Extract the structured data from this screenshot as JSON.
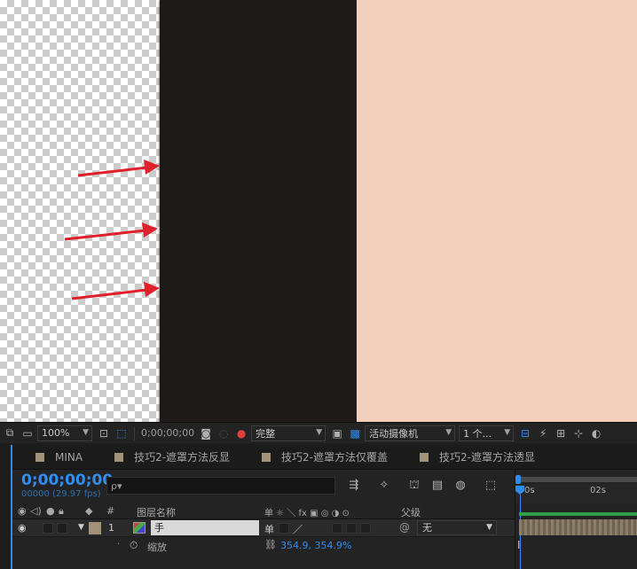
{
  "colors": {
    "accent_blue": "#2d8ceb",
    "timecode_blue": "#2e8ff0",
    "arrow_red": "#e0202a",
    "skin": "#f2cfbd",
    "dark_layer": "#1e1a19",
    "label_swatch": "#a3927a",
    "comp_bar_green": "#2fa04a"
  },
  "toolbar": {
    "zoom": "100%",
    "timecode": "0;00;00;00",
    "resolution": "完整",
    "camera": "活动摄像机",
    "views": "1 个..."
  },
  "tabs": [
    {
      "label": "MINA"
    },
    {
      "label": "技巧2-遮罩方法反显"
    },
    {
      "label": "技巧2-遮罩方法仅覆盖"
    },
    {
      "label": "技巧2-遮罩方法透显"
    }
  ],
  "timeline": {
    "timecode": "0;00;00;00",
    "frames": "00000 (29.97 fps)",
    "search_placeholder": "ρ▾"
  },
  "columns": {
    "number": "#",
    "layer_name": "图层名称",
    "switches": "单 ☼ ＼ fx ▣ ◎ ◑ ⊙",
    "parent": "父级"
  },
  "layer": {
    "index": "1",
    "name": "手",
    "parent": "无"
  },
  "property": {
    "name": "缩放",
    "value": "354.9, 354.9%"
  },
  "ruler": {
    "tick_0": "0s",
    "tick_2": "02s"
  }
}
